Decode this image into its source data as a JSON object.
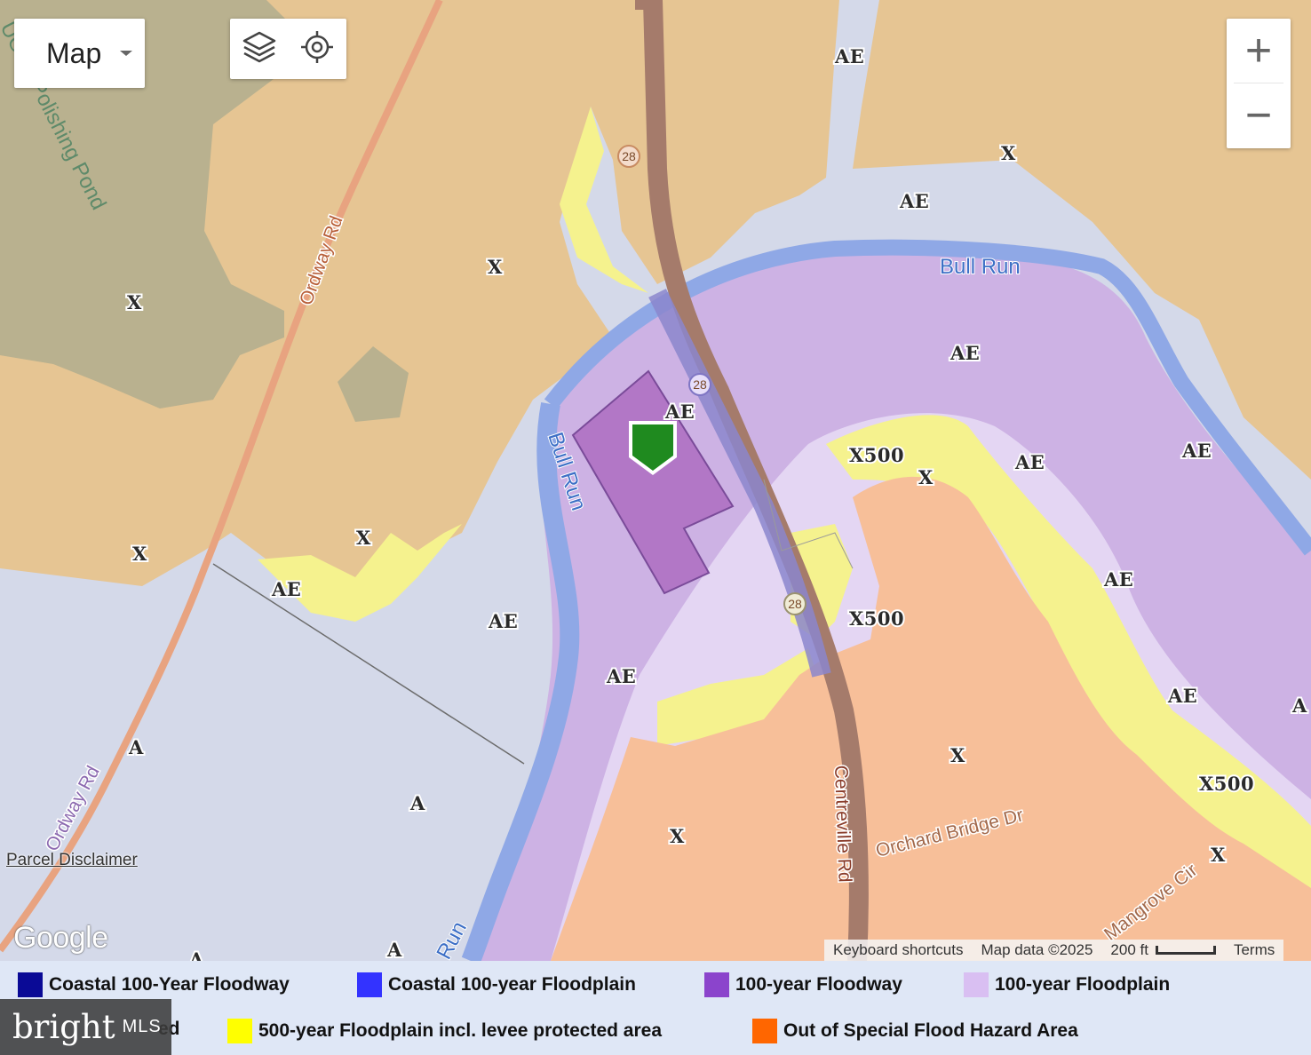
{
  "map": {
    "type_control": {
      "label": "Map"
    },
    "tools": {
      "layers_icon": "layers-icon",
      "locate_icon": "crosshair-locate-icon"
    },
    "zoom": {
      "in": "+",
      "out": "−"
    },
    "zones": {
      "z1": "AE",
      "z2": "X",
      "z3": "AE",
      "z4": "X",
      "z5": "X",
      "z6": "AE",
      "z7": "X",
      "z8": "AE",
      "z9": "X500",
      "z10": "X",
      "z11": "AE",
      "z12": "AE",
      "z13": "X",
      "z14": "X",
      "z15": "AE",
      "z16": "AE",
      "z17": "X500",
      "z18": "AE",
      "z19": "AE",
      "z20": "AE",
      "z21": "A",
      "z22": "A",
      "z23": "X",
      "z24": "X",
      "z25": "X500",
      "z26": "X",
      "z27": "A",
      "z28": "A",
      "z29": "AE",
      "z30": "A"
    },
    "roads": {
      "ordway_top": "Ordway Rd",
      "ordway_bottom": "Ordway Rd",
      "centreville": "Centreville Rd",
      "orchard_bridge": "Orchard Bridge Dr",
      "mangrove": "Mangrove Cir"
    },
    "water": {
      "bull_run_top": "Bull Run",
      "bull_run_west": "Bull Run",
      "bull_run_south": "Run",
      "pond": "UOSA Polishing Pond"
    },
    "route_shields": {
      "s1": "28",
      "s2": "28",
      "s3": "28"
    },
    "parcel_disclaimer": "Parcel Disclaimer",
    "google_logo": "Google",
    "attribution": {
      "shortcuts": "Keyboard shortcuts",
      "data": "Map data ©2025",
      "scale": "200 ft",
      "terms": "Terms"
    },
    "marker_icon": "map-pin-icon"
  },
  "legend": [
    {
      "label": "Coastal 100-Year Floodway",
      "color": "#0a0a96"
    },
    {
      "label": "Coastal 100-year Floodplain",
      "color": "#3333ff"
    },
    {
      "label": "100-year Floodway",
      "color": "#8b44cc"
    },
    {
      "label": "100-year Floodplain",
      "color": "#d9bff2"
    },
    {
      "label": "ed",
      "color": "#3333aa"
    },
    {
      "label": "500-year Floodplain incl. levee protected area",
      "color": "#ffff00"
    },
    {
      "label": "Out of Special Flood Hazard Area",
      "color": "#ff6600"
    }
  ],
  "watermark": {
    "brand": "bright",
    "suffix": "MLS"
  }
}
